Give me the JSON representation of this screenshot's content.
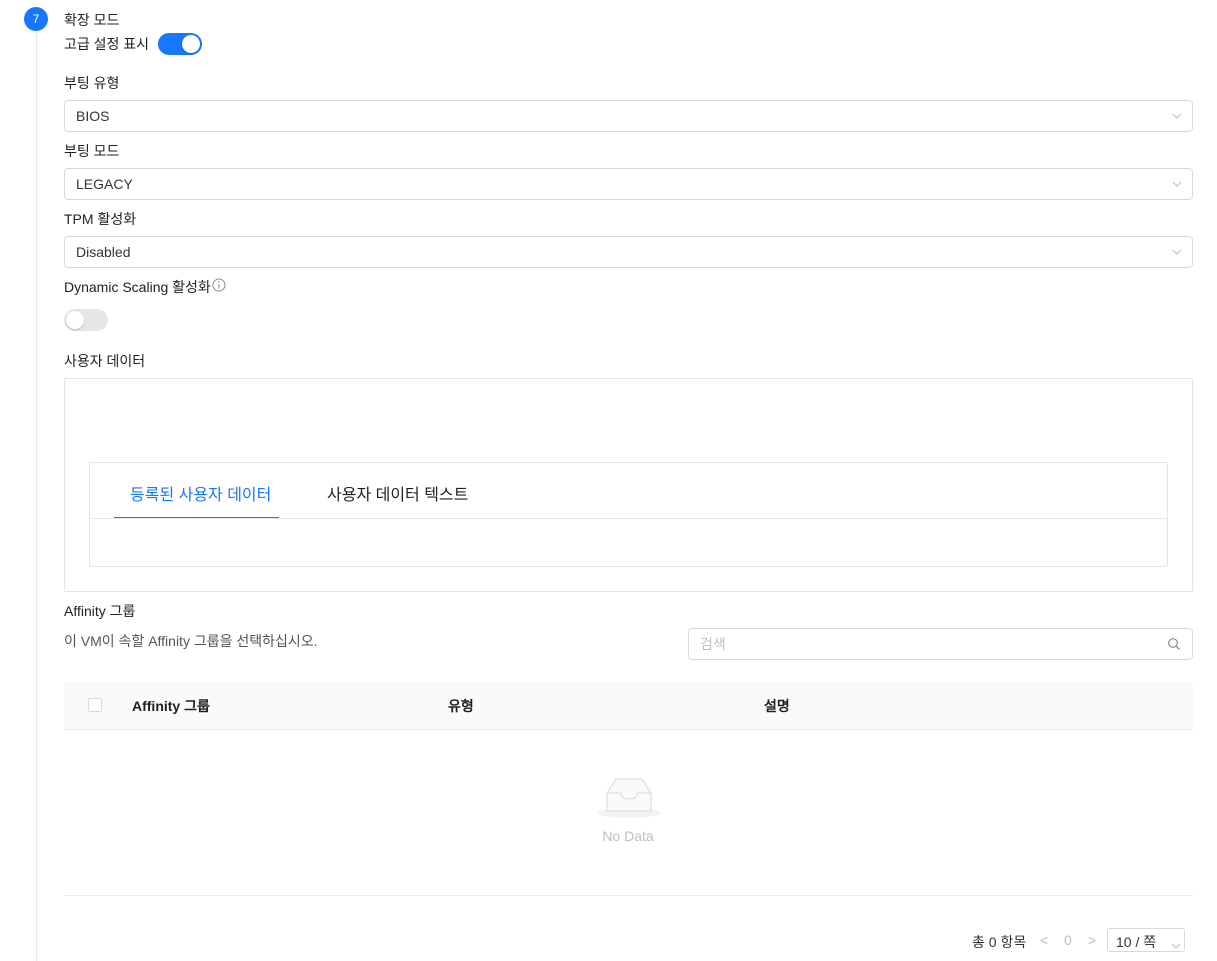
{
  "step": {
    "number": "7",
    "title": "확장 모드"
  },
  "advanced": {
    "label": "고급 설정 표시",
    "enabled": true
  },
  "boot_type": {
    "label": "부팅 유형",
    "value": "BIOS"
  },
  "boot_mode": {
    "label": "부팅 모드",
    "value": "LEGACY"
  },
  "tpm": {
    "label": "TPM 활성화",
    "value": "Disabled"
  },
  "dynamic_scaling": {
    "label": "Dynamic Scaling 활성화",
    "enabled": false
  },
  "user_data": {
    "label": "사용자 데이터",
    "tabs": [
      {
        "label": "등록된 사용자 데이터",
        "active": true
      },
      {
        "label": "사용자 데이터 텍스트",
        "active": false
      }
    ]
  },
  "affinity": {
    "label": "Affinity 그룹",
    "description": "이 VM이 속할 Affinity 그룹을 선택하십시오.",
    "search_placeholder": "검색",
    "columns": [
      "Affinity 그룹",
      "유형",
      "설명"
    ],
    "empty_text": "No Data"
  },
  "pagination": {
    "total": "총 0 항목",
    "prev": "<",
    "current": "0",
    "next": ">",
    "page_size": "10 / 쪽"
  }
}
